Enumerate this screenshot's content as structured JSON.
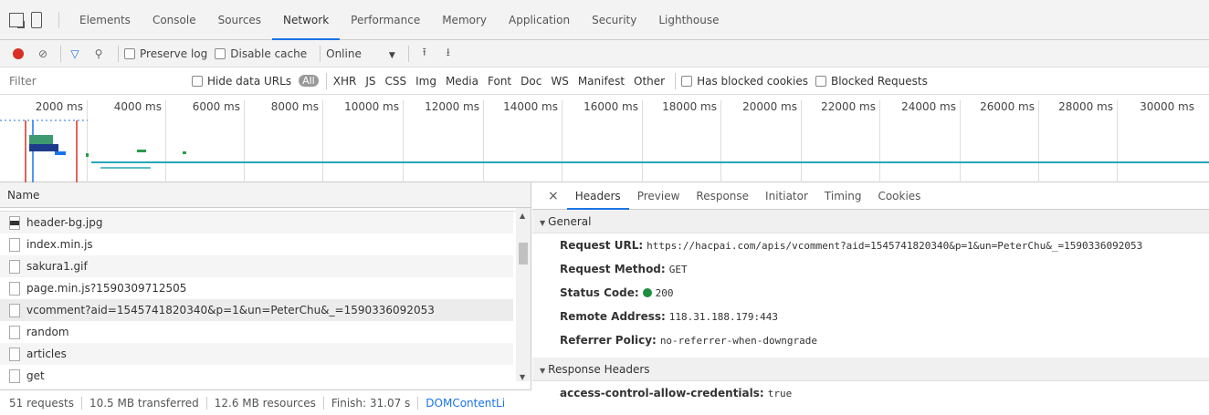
{
  "tabs": [
    "Elements",
    "Console",
    "Sources",
    "Network",
    "Performance",
    "Memory",
    "Application",
    "Security",
    "Lighthouse"
  ],
  "active_tab": "Network",
  "toolbar": {
    "preserve_log": "Preserve log",
    "disable_cache": "Disable cache",
    "throttle": "Online"
  },
  "filter": {
    "placeholder": "Filter",
    "hide_data_urls": "Hide data URLs",
    "types": [
      "All",
      "XHR",
      "JS",
      "CSS",
      "Img",
      "Media",
      "Font",
      "Doc",
      "WS",
      "Manifest",
      "Other"
    ],
    "has_blocked_cookies": "Has blocked cookies",
    "blocked_requests": "Blocked Requests"
  },
  "timeline": {
    "ticks": [
      "2000 ms",
      "4000 ms",
      "6000 ms",
      "8000 ms",
      "10000 ms",
      "12000 ms",
      "14000 ms",
      "16000 ms",
      "18000 ms",
      "20000 ms",
      "22000 ms",
      "24000 ms",
      "26000 ms",
      "28000 ms",
      "30000 ms"
    ]
  },
  "requests": {
    "header": "Name",
    "rows": [
      {
        "name": "header-bg.jpg",
        "kind": "img"
      },
      {
        "name": "index.min.js",
        "kind": "doc"
      },
      {
        "name": "sakura1.gif",
        "kind": "doc"
      },
      {
        "name": "page.min.js?1590309712505",
        "kind": "doc"
      },
      {
        "name": "vcomment?aid=1545741820340&p=1&un=PeterChu&_=1590336092053",
        "kind": "doc"
      },
      {
        "name": "random",
        "kind": "doc"
      },
      {
        "name": "articles",
        "kind": "doc"
      },
      {
        "name": "get",
        "kind": "doc"
      }
    ]
  },
  "status": {
    "requests": "51 requests",
    "transferred": "10.5 MB transferred",
    "resources": "12.6 MB resources",
    "finish": "Finish: 31.07 s",
    "dcl": "DOMContentLi"
  },
  "detail": {
    "tabs": [
      "Headers",
      "Preview",
      "Response",
      "Initiator",
      "Timing",
      "Cookies"
    ],
    "close": "×",
    "general_title": "General",
    "general": [
      {
        "key": "Request URL:",
        "value": "https://hacpai.com/apis/vcomment?aid=1545741820340&p=1&un=PeterChu&_=1590336092053"
      },
      {
        "key": "Request Method:",
        "value": "GET"
      },
      {
        "key": "Status Code:",
        "value": "200"
      },
      {
        "key": "Remote Address:",
        "value": "118.31.188.179:443"
      },
      {
        "key": "Referrer Policy:",
        "value": "no-referrer-when-downgrade"
      }
    ],
    "response_title": "Response Headers",
    "response": [
      {
        "key": "access-control-allow-credentials:",
        "value": "true"
      }
    ]
  }
}
